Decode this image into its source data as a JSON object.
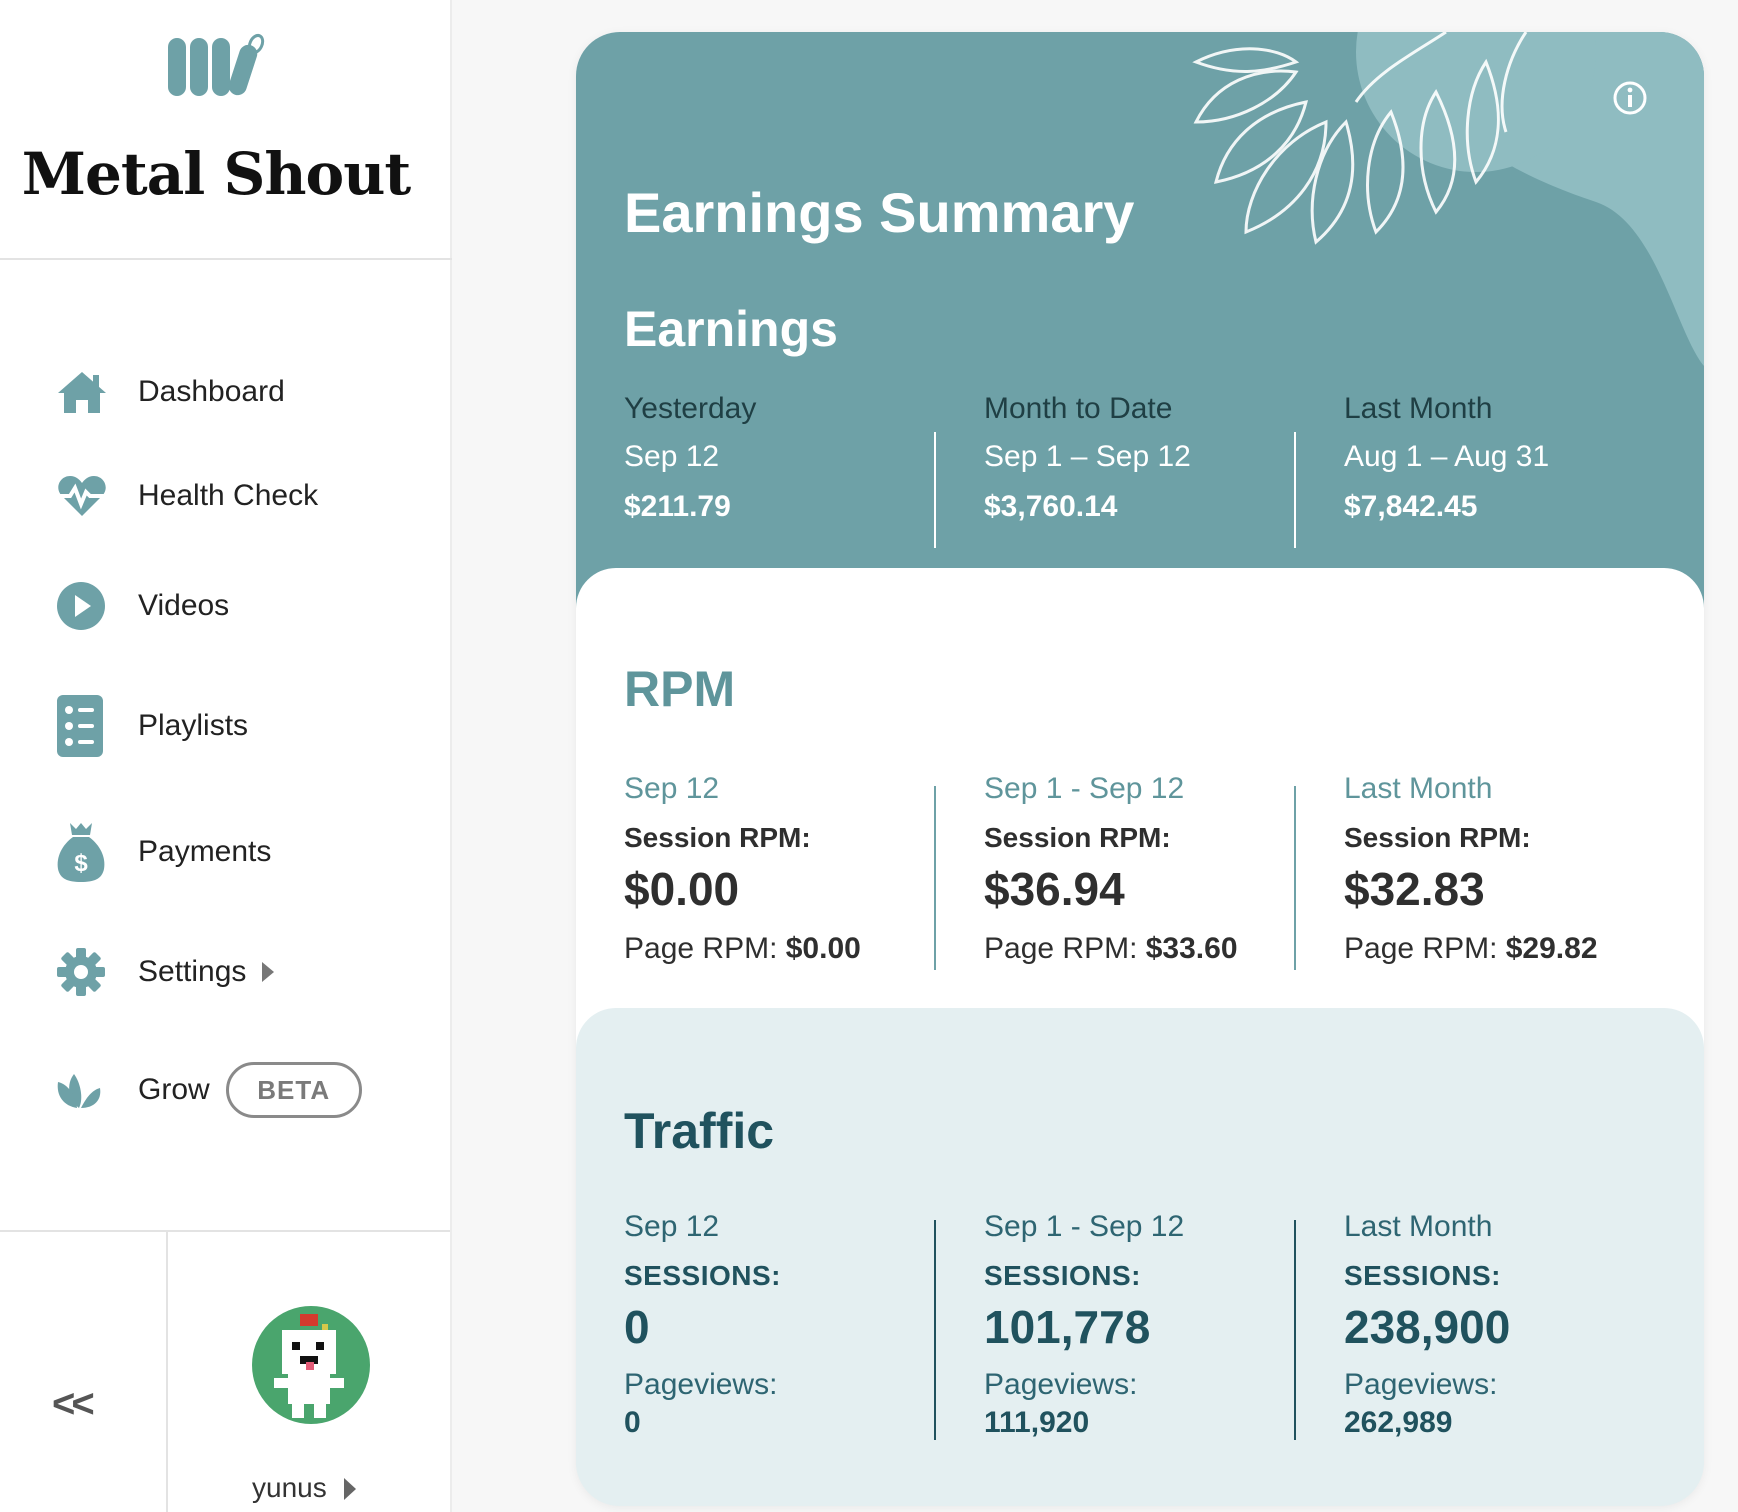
{
  "brand": {
    "name": "Metal Shout",
    "logo_icon": "mediavine-leaf-logo"
  },
  "sidebar": {
    "items": [
      {
        "label": "Dashboard",
        "icon": "home-icon"
      },
      {
        "label": "Health Check",
        "icon": "heartbeat-icon"
      },
      {
        "label": "Videos",
        "icon": "play-circle-icon"
      },
      {
        "label": "Playlists",
        "icon": "list-icon"
      },
      {
        "label": "Payments",
        "icon": "money-bag-icon"
      },
      {
        "label": "Settings",
        "icon": "gear-icon",
        "has_submenu": true
      },
      {
        "label": "Grow",
        "icon": "lotus-icon",
        "badge": "BETA"
      }
    ],
    "collapse_label": "<<",
    "user": {
      "name": "yunus"
    }
  },
  "summary": {
    "title": "Earnings Summary",
    "earnings": {
      "heading": "Earnings",
      "columns": [
        {
          "label": "Yesterday",
          "range": "Sep 12",
          "value": "$211.79"
        },
        {
          "label": "Month to Date",
          "range": "Sep 1 – Sep 12",
          "value": "$3,760.14"
        },
        {
          "label": "Last Month",
          "range": "Aug 1 – Aug 31",
          "value": "$7,842.45"
        }
      ]
    },
    "rpm": {
      "heading": "RPM",
      "columns": [
        {
          "range": "Sep 12",
          "metric_label": "Session RPM:",
          "metric_value": "$0.00",
          "page_label": "Page RPM:",
          "page_value": "$0.00"
        },
        {
          "range": "Sep 1 - Sep 12",
          "metric_label": "Session RPM:",
          "metric_value": "$36.94",
          "page_label": "Page RPM:",
          "page_value": "$33.60"
        },
        {
          "range": "Last Month",
          "metric_label": "Session RPM:",
          "metric_value": "$32.83",
          "page_label": "Page RPM:",
          "page_value": "$29.82"
        }
      ]
    },
    "traffic": {
      "heading": "Traffic",
      "columns": [
        {
          "range": "Sep 12",
          "metric_label": "SESSIONS:",
          "metric_value": "0",
          "pv_label": "Pageviews:",
          "pv_value": "0"
        },
        {
          "range": "Sep 1 - Sep 12",
          "metric_label": "SESSIONS:",
          "metric_value": "101,778",
          "pv_label": "Pageviews:",
          "pv_value": "111,920"
        },
        {
          "range": "Last Month",
          "metric_label": "SESSIONS:",
          "metric_value": "238,900",
          "pv_label": "Pageviews:",
          "pv_value": "262,989"
        }
      ]
    }
  },
  "colors": {
    "accent": "#6ea1a7",
    "accent_dark": "#20525e",
    "rpm_accent": "#5f959b",
    "traffic_bg": "#e4eff1"
  }
}
